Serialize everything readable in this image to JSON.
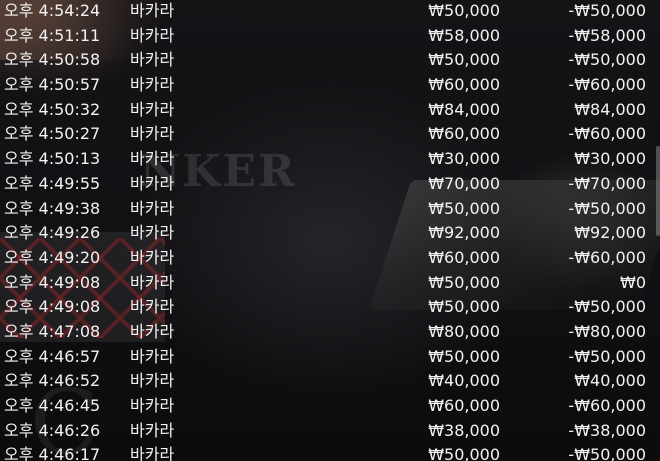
{
  "transactions": [
    {
      "time": "오후 4:54:24",
      "game": "바카라",
      "bet": "₩50,000",
      "result": "-₩50,000"
    },
    {
      "time": "오후 4:51:11",
      "game": "바카라",
      "bet": "₩58,000",
      "result": "-₩58,000"
    },
    {
      "time": "오후 4:50:58",
      "game": "바카라",
      "bet": "₩50,000",
      "result": "-₩50,000"
    },
    {
      "time": "오후 4:50:57",
      "game": "바카라",
      "bet": "₩60,000",
      "result": "-₩60,000"
    },
    {
      "time": "오후 4:50:32",
      "game": "바카라",
      "bet": "₩84,000",
      "result": "₩84,000"
    },
    {
      "time": "오후 4:50:27",
      "game": "바카라",
      "bet": "₩60,000",
      "result": "-₩60,000"
    },
    {
      "time": "오후 4:50:13",
      "game": "바카라",
      "bet": "₩30,000",
      "result": "₩30,000"
    },
    {
      "time": "오후 4:49:55",
      "game": "바카라",
      "bet": "₩70,000",
      "result": "-₩70,000"
    },
    {
      "time": "오후 4:49:38",
      "game": "바카라",
      "bet": "₩50,000",
      "result": "-₩50,000"
    },
    {
      "time": "오후 4:49:26",
      "game": "바카라",
      "bet": "₩92,000",
      "result": "₩92,000"
    },
    {
      "time": "오후 4:49:20",
      "game": "바카라",
      "bet": "₩60,000",
      "result": "-₩60,000"
    },
    {
      "time": "오후 4:49:08",
      "game": "바카라",
      "bet": "₩50,000",
      "result": "₩0"
    },
    {
      "time": "오후 4:49:08",
      "game": "바카라",
      "bet": "₩50,000",
      "result": "-₩50,000"
    },
    {
      "time": "오후 4:47:08",
      "game": "바카라",
      "bet": "₩80,000",
      "result": "-₩80,000"
    },
    {
      "time": "오후 4:46:57",
      "game": "바카라",
      "bet": "₩50,000",
      "result": "-₩50,000"
    },
    {
      "time": "오후 4:46:52",
      "game": "바카라",
      "bet": "₩40,000",
      "result": "₩40,000"
    },
    {
      "time": "오후 4:46:45",
      "game": "바카라",
      "bet": "₩60,000",
      "result": "-₩60,000"
    },
    {
      "time": "오후 4:46:26",
      "game": "바카라",
      "bet": "₩38,000",
      "result": "-₩38,000"
    },
    {
      "time": "오후 4:46:17",
      "game": "바카라",
      "bet": "₩50,000",
      "result": "-₩50,000"
    }
  ],
  "background": {
    "banner_text": "NKER"
  }
}
